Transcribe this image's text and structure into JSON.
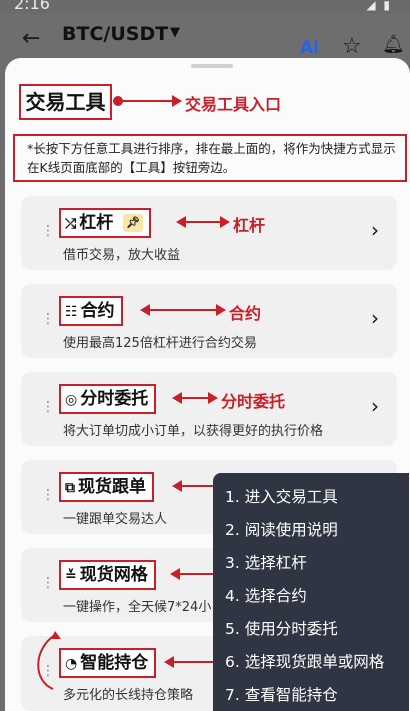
{
  "status_bar": {
    "time": "2:16",
    "icons": "◢ ▮"
  },
  "app_bar": {
    "back_icon": "arrow-left-icon",
    "pair": "BTC/USDT",
    "ai_label": "Ai",
    "star_icon": "star-icon",
    "bell_icon": "bell-icon"
  },
  "sheet": {
    "title": "交易工具",
    "title_callout": "交易工具入口",
    "notice": "*长按下方任意工具进行排序，排在最上面的，将作为快捷方式显示在K线页面底部的【工具】按钮旁边。",
    "tools": [
      {
        "icon": "⤮",
        "name": "杠杆",
        "desc": "借币交易，放大收益",
        "callout": "杠杆",
        "pinned": true
      },
      {
        "icon": "☷",
        "name": "合约",
        "desc": "使用最高125倍杠杆进行合约交易",
        "callout": "合约"
      },
      {
        "icon": "◎",
        "name": "分时委托",
        "desc": "将大订单切成小订单，以获得更好的执行价格",
        "callout": "分时委托"
      },
      {
        "icon": "⧉",
        "name": "现货跟单",
        "desc": "一键跟单交易达人",
        "callout": ""
      },
      {
        "icon": "≚",
        "name": "现货网格",
        "desc": "一键操作，全天候7*24小",
        "callout": ""
      },
      {
        "icon": "◔",
        "name": "智能持仓",
        "desc": "多元化的长线持仓策略",
        "callout": ""
      }
    ]
  },
  "steps": [
    "1. 进入交易工具",
    "2. 阅读使用说明",
    "3. 选择杠杆",
    "4. 选择合约",
    "5. 使用分时委托",
    "6. 选择现货跟单或网格",
    "7. 查看智能持仓"
  ],
  "colors": {
    "annotation_red": "#c8202a",
    "menu_bg": "#2f3542",
    "ai_blue": "#2563eb"
  }
}
